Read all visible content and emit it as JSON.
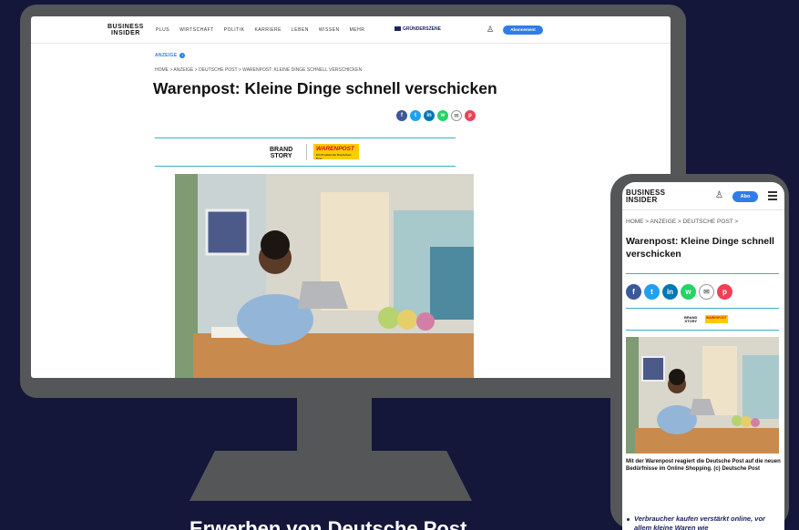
{
  "desktop": {
    "logo": [
      "BUSINESS",
      "INSIDER"
    ],
    "nav_items": [
      "PLUS",
      "WIRTSCHAFT",
      "POLITIK",
      "KARRIERE",
      "LEBEN",
      "WISSEN",
      "MEHR"
    ],
    "gruenderszene_label": "GRÜNDERSZENE",
    "abo_button": "Abonnement",
    "anzeige_label": "ANZEIGE",
    "breadcrumb": "HOME > ANZEIGE > DEUTSCHE POST > WARENPOST: KLEINE DINGE SCHNELL VERSCHICKEN",
    "article_title": "Warenpost: Kleine Dinge schnell verschicken",
    "brand_story": [
      "BRAND",
      "STORY"
    ],
    "warenpost_logo": "WARENPOST",
    "warenpost_tagline": "Ein Produkt der Deutschen Post"
  },
  "mobile": {
    "logo": [
      "BUSINESS",
      "INSIDER"
    ],
    "abo_button": "Abo",
    "breadcrumb": "HOME > ANZEIGE > DEUTSCHE POST >",
    "article_title": "Warenpost: Kleine Dinge schnell verschicken",
    "brand_story": [
      "BRAND",
      "STORY"
    ],
    "warenpost_logo": "WARENPOST",
    "caption": "Mit der Warenpost reagiert die Deutsche Post auf die neuen Bedürfnisse im Online Shopping. (c) Deutsche Post",
    "bullet": "Verbraucher kaufen verstärkt online, vor allem kleine Waren wie"
  },
  "share_icons": [
    {
      "name": "facebook-icon",
      "glyph": "f",
      "color": "#3b5998"
    },
    {
      "name": "twitter-icon",
      "glyph": "t",
      "color": "#1da1f2"
    },
    {
      "name": "linkedin-icon",
      "glyph": "in",
      "color": "#0077b5"
    },
    {
      "name": "whatsapp-icon",
      "glyph": "w",
      "color": "#25d366"
    },
    {
      "name": "mail-icon",
      "glyph": "✉",
      "color": "#ffffff"
    },
    {
      "name": "pocket-icon",
      "glyph": "p",
      "color": "#ef4056"
    }
  ],
  "bottom_heading": "Erwerben von Deutsche Post",
  "colors": {
    "background": "#14163a",
    "device": "#545658",
    "accent": "#2e7de9",
    "teal_rule": "#3ab0c8"
  }
}
